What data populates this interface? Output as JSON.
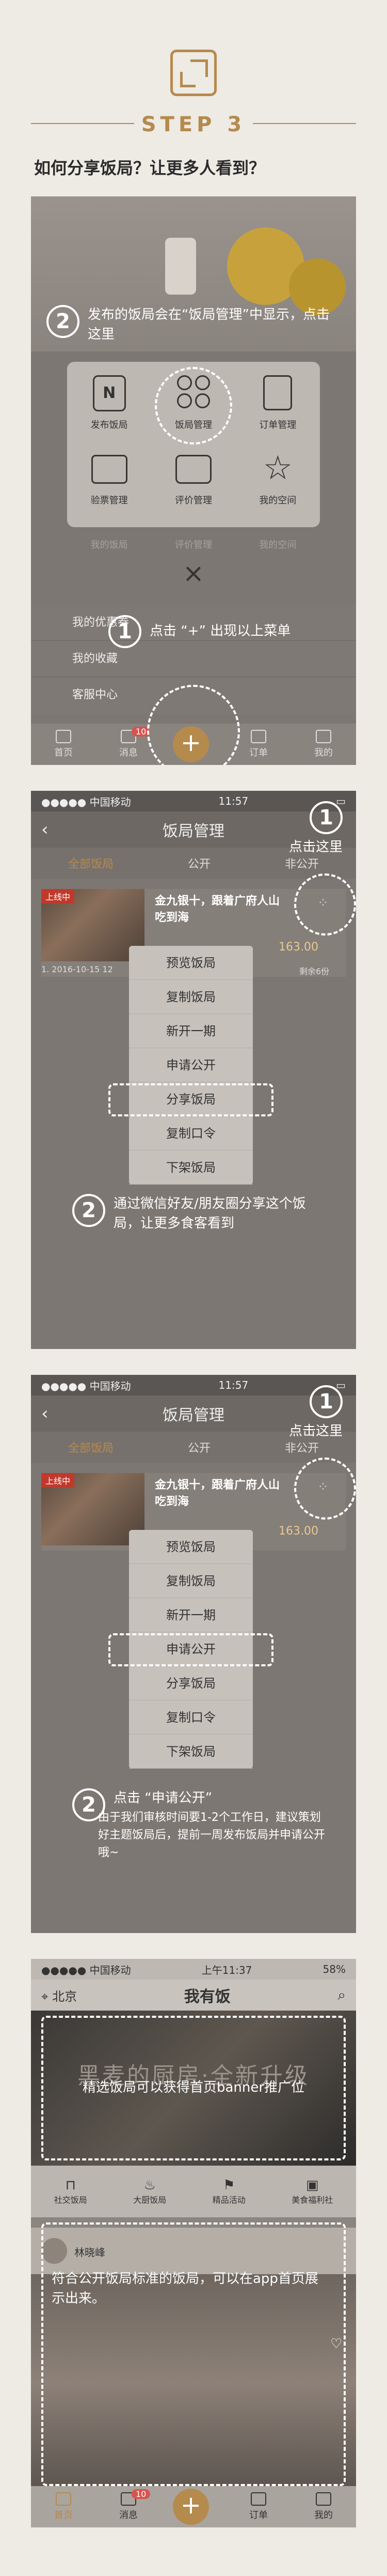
{
  "header": {
    "step_title": "STEP 3",
    "question": "如何分享饭局？让更多人看到？"
  },
  "shot1": {
    "note2": "发布的饭局会在“饭局管理”中显示，点击这里",
    "grid": [
      {
        "label": "发布饭局",
        "icon": "n-card-icon"
      },
      {
        "label": "饭局管理",
        "icon": "clover-icon"
      },
      {
        "label": "订单管理",
        "icon": "document-icon"
      },
      {
        "label": "验票管理",
        "icon": "ticket-icon"
      },
      {
        "label": "评价管理",
        "icon": "chat-icon"
      },
      {
        "label": "我的空间",
        "icon": "star-icon"
      }
    ],
    "faded": [
      "我的饭局",
      "评价管理",
      "我的空间"
    ],
    "list": [
      "我的优惠券",
      "我的收藏",
      "客服中心"
    ],
    "note1": "点击 “+” 出现以上菜单",
    "tabs": [
      "首页",
      "消息",
      "",
      "订单",
      "我的"
    ],
    "badge": "10"
  },
  "shot2": {
    "status": {
      "carrier": "●●●●● 中国移动",
      "time": "11:57"
    },
    "title": "饭局管理",
    "tabs": [
      "全部饭局",
      "公开",
      "非公开"
    ],
    "card": {
      "tag": "上线中",
      "title": "金九银十，跟着广府人山吃到海",
      "price": "163.00",
      "date": "1. 2016-10-15 12",
      "remain": "剩余6份"
    },
    "note1": "点击这里",
    "menu": [
      "预览饭局",
      "复制饭局",
      "新开一期",
      "申请公开",
      "分享饭局",
      "复制口令",
      "下架饭局"
    ],
    "note2": "通过微信好友/朋友圈分享这个饭局，让更多食客看到"
  },
  "shot3": {
    "status": {
      "carrier": "●●●●● 中国移动",
      "time": "11:57"
    },
    "title": "饭局管理",
    "tabs": [
      "全部饭局",
      "公开",
      "非公开"
    ],
    "card": {
      "tag": "上线中",
      "title": "金九银十，跟着广府人山吃到海",
      "price": "163.00"
    },
    "note1": "点击这里",
    "menu": [
      "预览饭局",
      "复制饭局",
      "新开一期",
      "申请公开",
      "分享饭局",
      "复制口令",
      "下架饭局"
    ],
    "note2_title": "点击 “申请公开”",
    "note2": "由于我们审核时间要1-2个工作日，建议策划好主题饭局后，提前一周发布饭局并申请公开哦~"
  },
  "shot4": {
    "status": {
      "carrier": "●●●●● 中国移动",
      "time": "上午11:37",
      "battery": "58%"
    },
    "city": "北京",
    "logo": "我有饭",
    "banner_title": "黑麦的厨房·全新升级",
    "banner_note": "精选饭局可以获得首页banner推广位",
    "cats": [
      "社交饭局",
      "大厨饭局",
      "精品活动",
      "美食福利社"
    ],
    "host": "林晓峰",
    "note": "符合公开饭局标准的饭局，可以在app首页展示出来。",
    "tabs": [
      "首页",
      "消息",
      "",
      "订单",
      "我的"
    ],
    "badge": "10"
  }
}
